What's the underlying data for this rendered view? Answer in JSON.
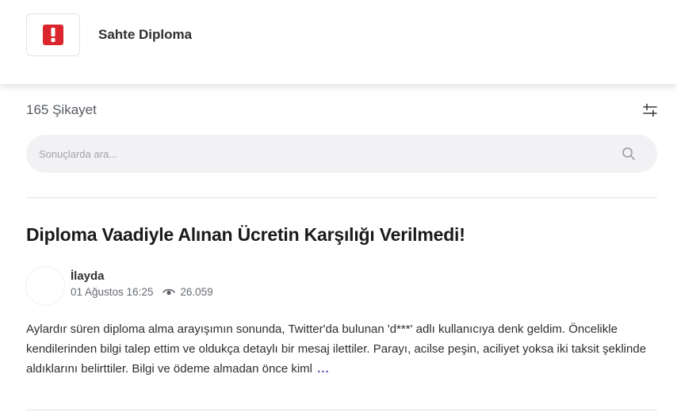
{
  "header": {
    "logo_icon": "exclamation-icon",
    "logo_color": "#d9252b",
    "brand_name": "Sahte Diploma"
  },
  "results": {
    "count_label": "165 Şikayet",
    "filter_icon": "sliders-icon"
  },
  "search": {
    "placeholder": "Sonuçlarda ara...",
    "value": "",
    "icon": "search-icon"
  },
  "complaint": {
    "title": "Diploma Vaadiyle Alınan Ücretin Karşılığı Verilmedi!",
    "author": "İlayda",
    "date": "01 Ağustos 16:25",
    "views_icon": "eye-icon",
    "views": "26.059",
    "excerpt": "Aylardır süren diploma alma arayışımın sonunda, Twitter'da bulunan 'd***' adlı kullanıcıya denk geldim. Öncelikle kendilerinden bilgi talep ettim ve oldukça detaylı bir mesaj ilettiler. Parayı, acilse peşin, aciliyet yoksa iki taksit şeklinde aldıklarını belirttiler. Bilgi ve ödeme almadan önce kiml",
    "more_label": "...",
    "accent_color": "#4e4aa8"
  }
}
